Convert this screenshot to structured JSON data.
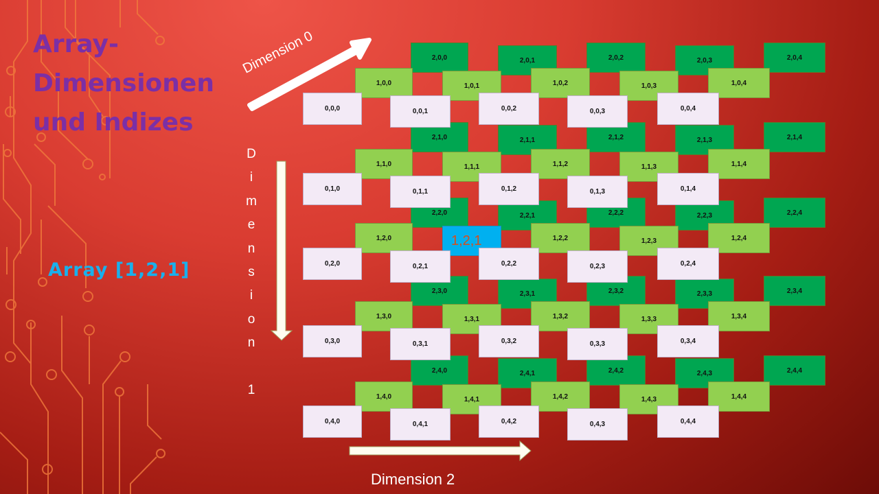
{
  "title": "Array-Dimensionen und Indizes",
  "title_lines": [
    "Array-",
    "Dimensionen",
    "und Indizes"
  ],
  "subtitle": "Array [1,2,1]",
  "labels": {
    "dimension0": "Dimension 0",
    "dimension1": "Dimension 1",
    "dimension2": "Dimension 2"
  },
  "highlight": "1,2,1",
  "grid": {
    "dim0": 3,
    "dim1": 5,
    "dim2": 5
  },
  "colors": {
    "layer0": "#f3eaf6",
    "layer1": "#92d050",
    "layer2": "#00a651",
    "highlight": "#00b0f0",
    "highlight_text": "#d6501c",
    "title": "#7b2fa6",
    "subtitle": "#1ab0ec",
    "background": "#d93c31"
  }
}
